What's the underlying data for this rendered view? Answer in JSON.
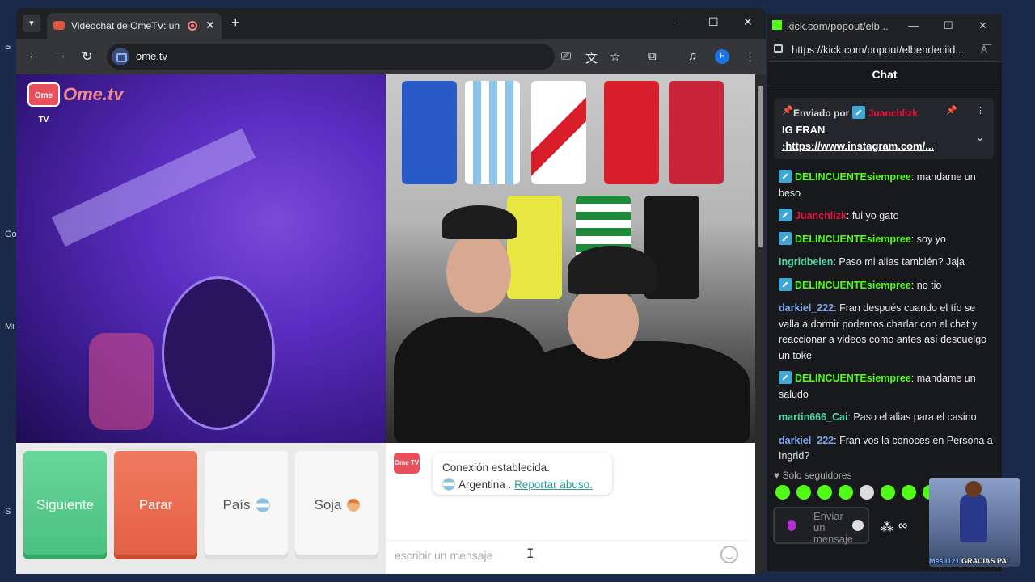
{
  "desktop": {
    "labels": [
      "P",
      "Go",
      "Mi",
      "S"
    ]
  },
  "browser": {
    "tab_title": "Videochat de OmeTV: una a",
    "url": "ome.tv",
    "profile_initial": "F"
  },
  "ometv": {
    "logo_badge": "Ome TV",
    "logo_text": "Ome.tv",
    "buttons": {
      "next": "Siguiente",
      "stop": "Parar",
      "country": "País",
      "gender": "Soja"
    },
    "chat": {
      "avatar_label": "Ome TV",
      "status": "Conexión establecida.",
      "country": "Argentina .",
      "report": "Reportar abuso.",
      "input_placeholder": "escribir un mensaje"
    }
  },
  "kick": {
    "window_title": "kick.com/popout/elb...",
    "url": "https://kick.com/popout/elbendeciid...",
    "header": "Chat",
    "pinned": {
      "sent_by_label": "Enviado por",
      "sent_by_user": "Juanchlizk",
      "title": "IG FRAN",
      "link": ":https://www.instagram.com/..."
    },
    "messages": [
      {
        "user": "DELINCUENTEsiempree",
        "text": "mandame un beso",
        "color": "green",
        "badge": true
      },
      {
        "user": "Juanchlizk",
        "text": "fui yo gato",
        "color": "red",
        "badge": true
      },
      {
        "user": "DELINCUENTEsiempree",
        "text": "soy yo",
        "color": "green",
        "badge": true
      },
      {
        "user": "Ingridbelen",
        "text": "Paso mi alias también? Jaja",
        "color": "teal",
        "badge": false
      },
      {
        "user": "DELINCUENTEsiempree",
        "text": "no tio",
        "color": "green",
        "badge": true
      },
      {
        "user": "darkiel_222",
        "text": "Fran después cuando el tío se valla a dormir podemos charlar con el chat y reaccionar a videos como antes así descuelgo un toke",
        "color": "blue",
        "badge": false
      },
      {
        "user": "DELINCUENTEsiempree",
        "text": "mandame un saludo",
        "color": "green",
        "badge": true
      },
      {
        "user": "martin666_Cai",
        "text": "Paso el alias para el casino",
        "color": "teal",
        "badge": false
      },
      {
        "user": "darkiel_222",
        "text": "Fran vos la conoces en Persona a Ingrid?",
        "color": "blue",
        "badge": false
      }
    ],
    "followers_only": "Solo seguidores",
    "send_placeholder": "Enviar un mensaje"
  },
  "webcam_overlay": {
    "name": "Mesii121",
    "text": "GRACIAS PA!"
  },
  "colors": {
    "kick_green": "#53fc18",
    "next_green": "#48c07e",
    "stop_red": "#e35f44"
  }
}
